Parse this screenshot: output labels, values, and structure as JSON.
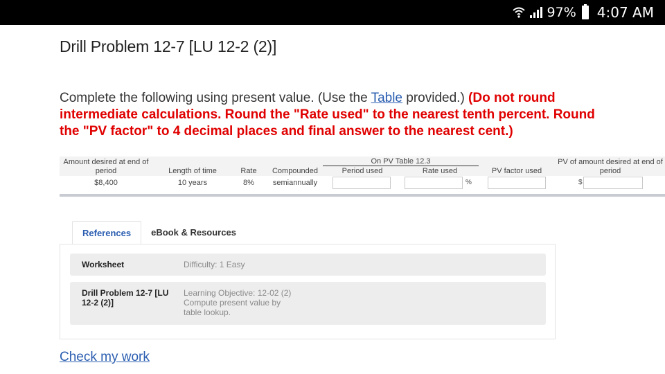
{
  "status_bar": {
    "battery": "97%",
    "time": "4:07 AM",
    "icons": [
      "wifi-icon",
      "signal-icon",
      "battery-icon"
    ]
  },
  "title": "Drill Problem 12-7 [LU 12-2 (2)]",
  "instructions": {
    "prefix": "Complete the following using present value. (Use the ",
    "link": "Table",
    "middle": " provided.) ",
    "warning": "(Do not round intermediate calculations. Round the \"Rate used\" to the nearest tenth percent. Round the \"PV factor\" to 4 decimal places and final answer to the nearest cent.)"
  },
  "table": {
    "headers": {
      "amount": "Amount desired at end of period",
      "length": "Length of time",
      "rate": "Rate",
      "compounded": "Compounded",
      "group": "On PV Table 12.3",
      "period_used": "Period used",
      "rate_used": "Rate used",
      "pv_factor": "PV factor used",
      "pv_amount": "PV of amount desired at end of period"
    },
    "row": {
      "amount": "$8,400",
      "length": "10 years",
      "rate": "8%",
      "compounded": "semiannually",
      "period_used": "",
      "rate_used": "",
      "rate_unit": "%",
      "pv_factor": "",
      "currency": "$",
      "pv_amount": ""
    }
  },
  "tabs": [
    {
      "label": "References",
      "active": true
    },
    {
      "label": "eBook & Resources",
      "active": false
    }
  ],
  "references": [
    {
      "label": "Worksheet",
      "meta": "Difficulty: 1 Easy"
    },
    {
      "label": "Drill Problem 12-7 [LU 12-2 (2)]",
      "meta": "Learning Objective: 12-02 (2) Compute present value by table lookup."
    }
  ],
  "check_link": "Check my work",
  "colors": {
    "link": "#2a5db0",
    "warning": "#e00000",
    "status_bar": "#000000",
    "panel_row": "#ededed"
  }
}
